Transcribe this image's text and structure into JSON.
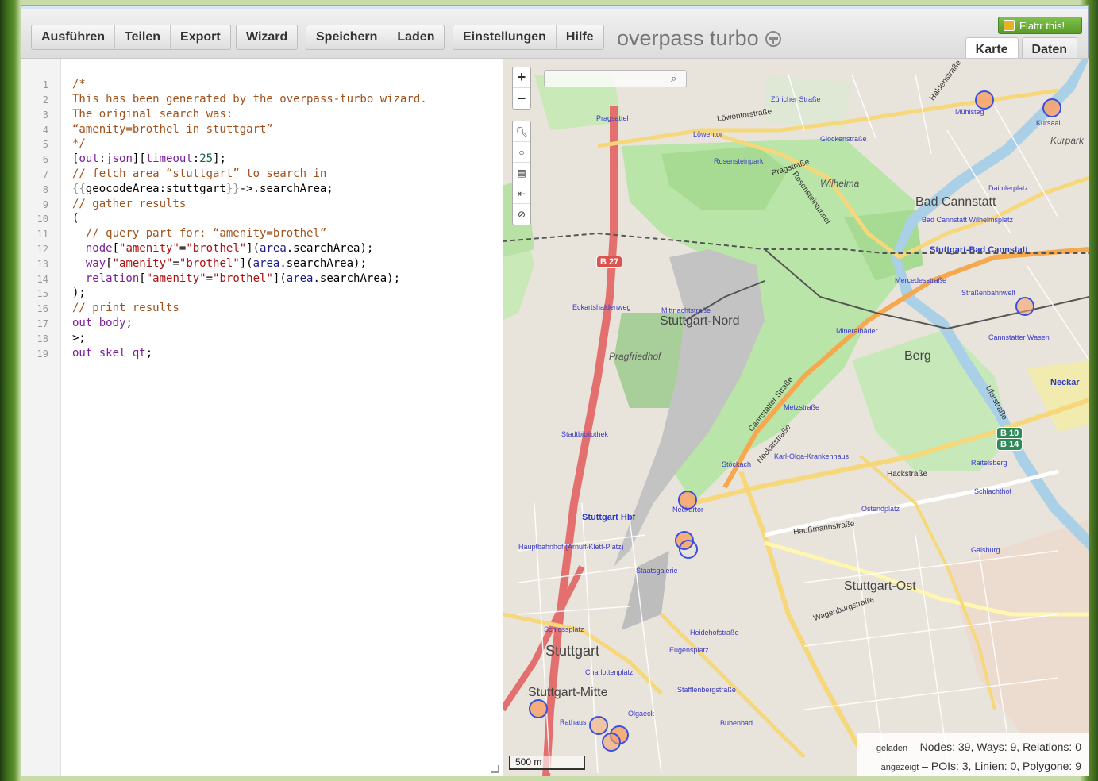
{
  "toolbar": {
    "group1": [
      "Ausführen",
      "Teilen",
      "Export"
    ],
    "group2": [
      "Wizard"
    ],
    "group3": [
      "Speichern",
      "Laden"
    ],
    "group4": [
      "Einstellungen",
      "Hilfe"
    ],
    "brand": "overpass turbo",
    "flattr": "Flattr this!",
    "tabs": [
      "Karte",
      "Daten"
    ]
  },
  "editor": {
    "line_numbers": [
      "1",
      "2",
      "3",
      "4",
      "5",
      "6",
      "7",
      "8",
      "9",
      "10",
      "11",
      "12",
      "13",
      "14",
      "15",
      "16",
      "17",
      "18",
      "19"
    ]
  },
  "map": {
    "search_placeholder": "",
    "zoom_in": "+",
    "zoom_out": "−",
    "scale": "500 m",
    "labels": {
      "stuttgart_nord": "Stuttgart-Nord",
      "bad_cannstatt": "Bad Cannstatt",
      "berg": "Berg",
      "stuttgart_ost": "Stuttgart-Ost",
      "stuttgart": "Stuttgart",
      "stuttgart_mitte": "Stuttgart-Mitte",
      "wilhelma": "Wilhelma",
      "pragfriedhof": "Pragfriedhof",
      "kurpark": "Kurpark",
      "stuttgart_hbf": "Stuttgart Hbf",
      "stuttgart_bad_cannstatt": "Stuttgart-Bad Cannstatt",
      "neckar": "Neckar",
      "pragstrasse": "Pragstraße",
      "loewentorstrasse": "Löwentorstraße",
      "neckarstrasse": "Neckarstraße",
      "cannstatter_strasse": "Cannstatter Straße",
      "hackstrasse": "Hackstraße",
      "haussmannstrasse": "Haußmannstraße",
      "wagenburgstrasse": "Wagenburgstraße",
      "uferstrasse": "Uferstraße",
      "haldenstrasse": "Haldenstraße",
      "rosensteintunnel": "Rosensteintunnel",
      "zuricher_strasse": "Züricher Straße",
      "glockenstrasse": "Glockenstraße",
      "muehlsteg": "Mühlsteg",
      "kursaal": "Kursaal",
      "mittnachtstrasse": "Mittnachtstraße",
      "eckartshaldenweg": "Eckartshaldenweg",
      "neckartor": "Neckartor",
      "staatsgalerie": "Staatsgalerie",
      "rathaus": "Rathaus",
      "olgaeck": "Olgaeck",
      "schlossplatz": "Schlossplatz",
      "charlottenplatz": "Charlottenplatz",
      "eugensplatz": "Eugensplatz",
      "stadtbibliothek": "Stadtbibliothek",
      "metzstrasse": "Metzstraße",
      "raitelsberg": "Raitelsberg",
      "ostendplatz": "Ostendplatz",
      "gaisburg": "Gaisburg",
      "strassenbahnwelt": "Straßenbahnwelt",
      "mercedesstrasse": "Mercedesstraße",
      "mineralbaeder": "Mineralbäder",
      "cannstatter_wasen": "Cannstatter Wasen",
      "rosensteinpark": "Rosensteinpark",
      "pragsattel": "Pragsattel",
      "loewentor": "Löwentor",
      "daimlerplatz": "Daimlerplatz",
      "wilhelmsplatz": "Bad Cannstatt Wilhelmsplatz",
      "stoeckach": "Stöckach",
      "karl_olga": "Karl-Olga-Krankenhaus",
      "schlachthof": "Schlachthof",
      "hauptbahnhof": "Hauptbahnhof (Arnulf-Klett-Platz)",
      "heidehofstrasse": "Heidehofstraße",
      "stafflenbergstrasse": "Stafflenbergstraße",
      "bubenbad": "Bubenbad",
      "b27": "B 27",
      "b10": "B 10",
      "b14": "B 14"
    }
  },
  "stats": {
    "loaded_label": "geladen",
    "loaded": "Nodes: 39, Ways: 9, Relations: 0",
    "shown_label": "angezeigt",
    "shown": "POIs: 3, Linien: 0, Polygone: 9"
  },
  "colors": {
    "comment": "#a0521d",
    "keyword": "#7a1f9a",
    "string": "#aa1111",
    "poi_fill": "#f6a36a",
    "poi_stroke": "#3b4fe0"
  }
}
